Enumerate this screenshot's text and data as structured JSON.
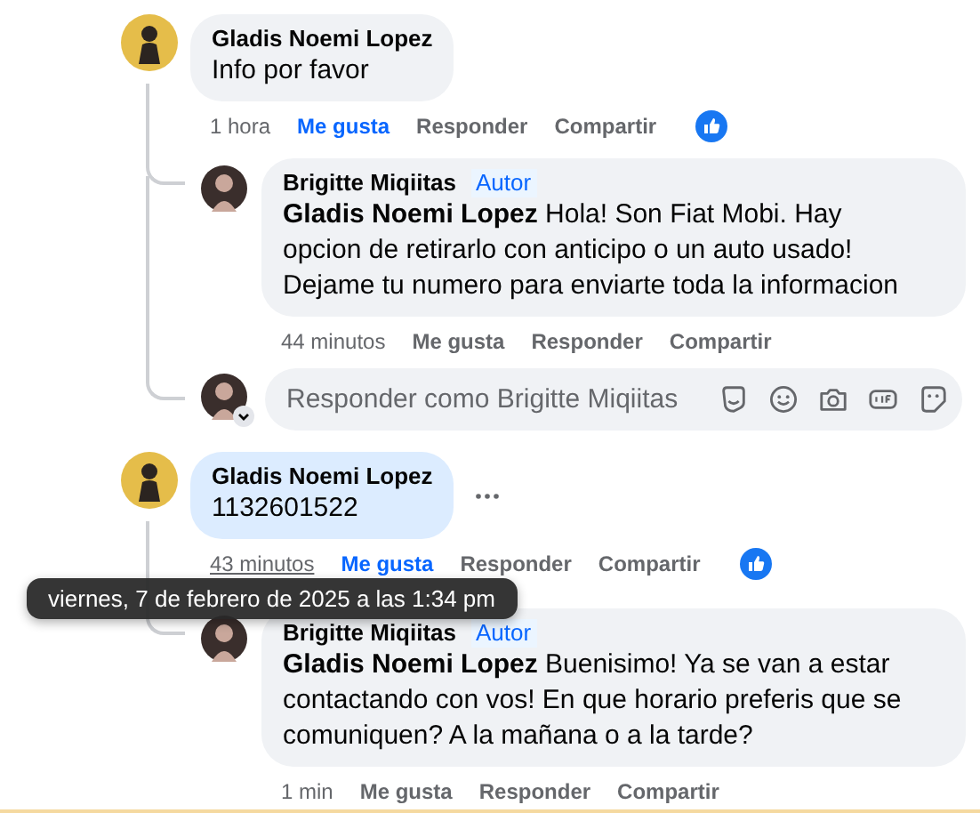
{
  "comments": [
    {
      "author": "Gladis Noemi Lopez",
      "text": "Info por favor",
      "highlighted": false,
      "more_menu": false,
      "time": "1 hora",
      "time_hovered": false,
      "like_label": "Me gusta",
      "liked": true,
      "reply_label": "Responder",
      "share_label": "Compartir",
      "reaction": true,
      "replies": [
        {
          "author": "Brigitte Miqiitas",
          "badge": "Autor",
          "text": "**Gladis Noemi Lopez** Hola! Son Fiat Mobi. Hay opcion de retirarlo con anticipo o un auto usado! Dejame tu numero para enviarte toda la informacion",
          "time": "44 minutos",
          "like_label": "Me gusta",
          "liked": false,
          "reply_label": "Responder",
          "share_label": "Compartir"
        }
      ],
      "composer": {
        "placeholder": "Responder como Brigitte Miqiitas"
      }
    },
    {
      "author": "Gladis Noemi Lopez",
      "text": "1132601522",
      "highlighted": true,
      "more_menu": true,
      "time": "43 minutos",
      "time_hovered": true,
      "like_label": "Me gusta",
      "liked": true,
      "reply_label": "Responder",
      "share_label": "Compartir",
      "reaction": true,
      "replies": [
        {
          "author": "Brigitte Miqiitas",
          "badge": "Autor",
          "text": "**Gladis Noemi Lopez** Buenisimo! Ya se van a estar contactando con vos! En que horario preferis que se comuniquen? A la mañana o a la tarde?",
          "time": "1 min",
          "like_label": "Me gusta",
          "liked": false,
          "reply_label": "Responder",
          "share_label": "Compartir"
        }
      ]
    }
  ],
  "tooltip": {
    "text": "viernes, 7 de febrero de 2025 a las 1:34 pm"
  }
}
